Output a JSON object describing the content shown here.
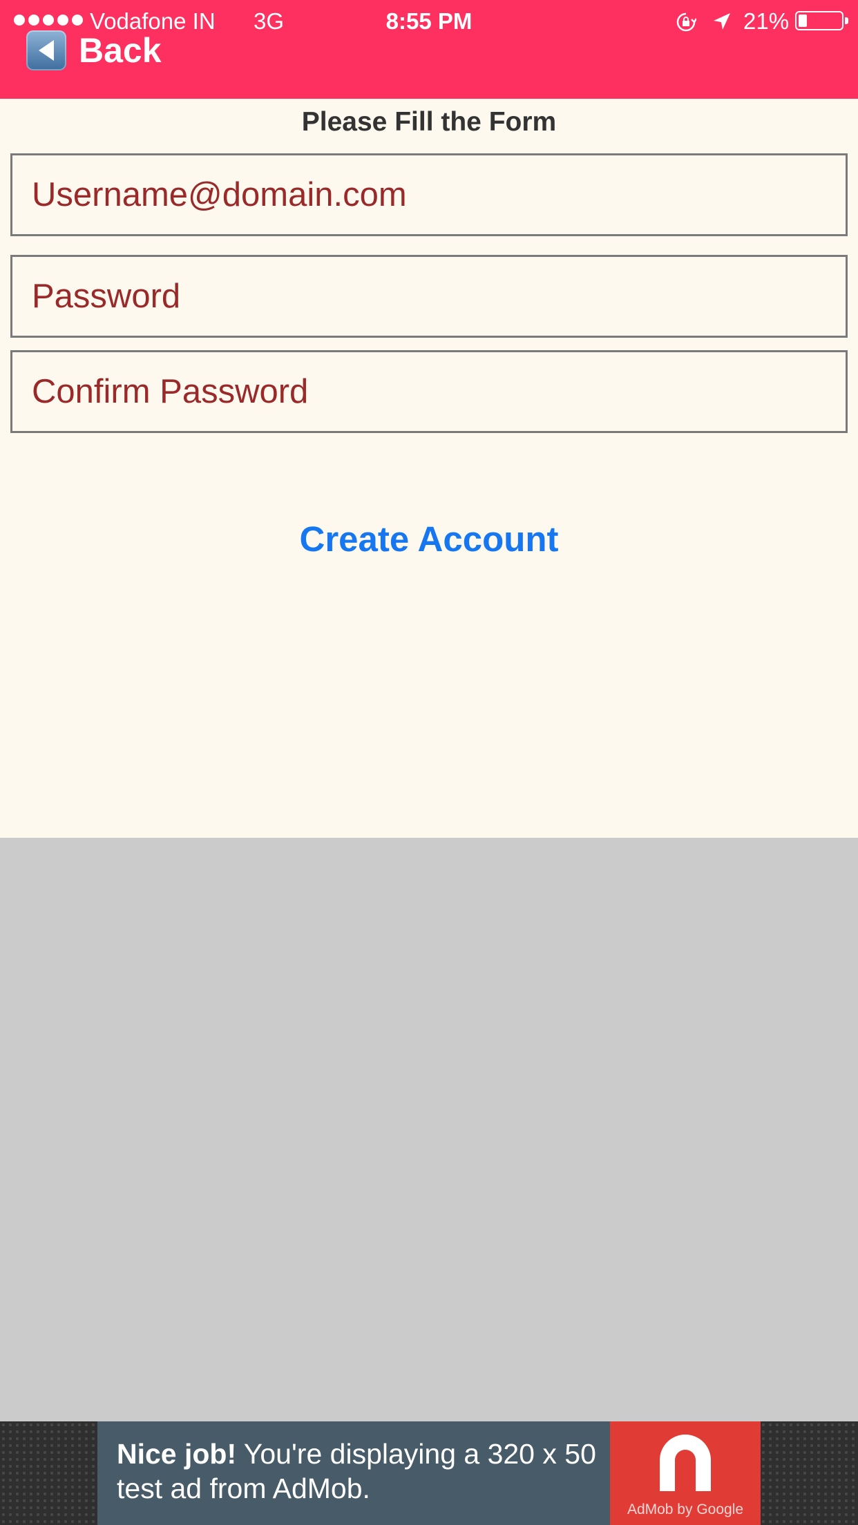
{
  "status_bar": {
    "carrier": "Vodafone IN",
    "network": "3G",
    "time": "8:55 PM",
    "battery_percent": "21%",
    "battery_level": 0.21
  },
  "nav": {
    "back_label": "Back",
    "bar_color": "#fe3060"
  },
  "form": {
    "title": "Please Fill the Form",
    "username_placeholder": "Username@domain.com",
    "password_placeholder": "Password",
    "confirm_password_placeholder": "Confirm Password",
    "submit_label": "Create Account"
  },
  "ad": {
    "headline": "Nice job!",
    "body_line1": " You're displaying a 320 x 50",
    "body_line2": "test ad from AdMob.",
    "logo_caption": "AdMob by Google"
  }
}
